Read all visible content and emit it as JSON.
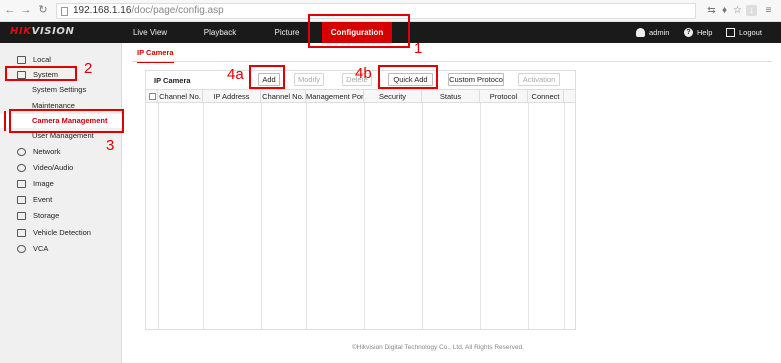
{
  "browser": {
    "url_host": "192.168.1.16",
    "url_path": "/doc/page/config.asp"
  },
  "app": {
    "logo_a": "HIK",
    "logo_b": "VISION",
    "top_tabs": [
      "Live View",
      "Playback",
      "Picture",
      "Configuration"
    ],
    "active_tab": "Configuration",
    "user_label": "admin",
    "help_label": "Help",
    "logout_label": "Logout"
  },
  "sidebar": {
    "items": [
      {
        "label": "Local",
        "icon": "monitor-icon"
      },
      {
        "label": "System",
        "icon": "system-icon"
      },
      {
        "label": "System Settings"
      },
      {
        "label": "Maintenance"
      },
      {
        "label": "Camera Management"
      },
      {
        "label": "User Management"
      },
      {
        "label": "Network",
        "icon": "network-icon"
      },
      {
        "label": "Video/Audio",
        "icon": "video-audio-icon"
      },
      {
        "label": "Image",
        "icon": "image-icon"
      },
      {
        "label": "Event",
        "icon": "event-icon"
      },
      {
        "label": "Storage",
        "icon": "storage-icon"
      },
      {
        "label": "Vehicle Detection",
        "icon": "vehicle-icon"
      },
      {
        "label": "VCA",
        "icon": "vca-icon"
      }
    ],
    "active_item": "Camera Management"
  },
  "main": {
    "tab_label": "IP Camera",
    "panel_title": "IP Camera",
    "buttons": {
      "add": "Add",
      "modify": "Modify",
      "delete": "Delete",
      "quick_add": "Quick Add",
      "custom_protocol": "Custom Protoco",
      "activation": "Activation"
    },
    "columns": [
      "Channel No.",
      "IP Address",
      "Channel No.",
      "Management Port",
      "Security",
      "Status",
      "Protocol",
      "Connect"
    ],
    "footer": "©Hikvision Digital Technology Co., Ltd. All Rights Reserved."
  },
  "annotations": {
    "n1": "1",
    "n2": "2",
    "n3": "3",
    "n4a": "4a",
    "n4b": "4b"
  },
  "colors": {
    "accent": "#d50000",
    "annotation": "#e00000",
    "header_bg": "#1a1a1a"
  }
}
